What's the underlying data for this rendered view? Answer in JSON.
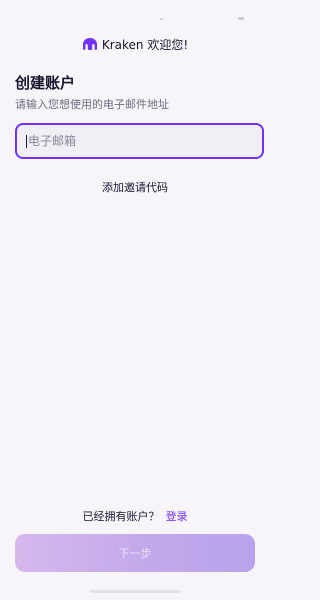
{
  "brand": {
    "name": "Kraken",
    "tagline": "欢迎您!",
    "title": "Kraken 欢迎您!",
    "accent_color": "#7132f5",
    "logo_icon": "kraken-logo-icon"
  },
  "form": {
    "title": "创建账户",
    "subtitle": "请输入您想使用的电子邮件地址",
    "email": {
      "value": "",
      "placeholder": "电子邮箱"
    },
    "invite_link": "添加邀请代码"
  },
  "footer": {
    "signin_prompt": "已经拥有账户？",
    "signin_link": "登录",
    "next_button": "下一步"
  }
}
